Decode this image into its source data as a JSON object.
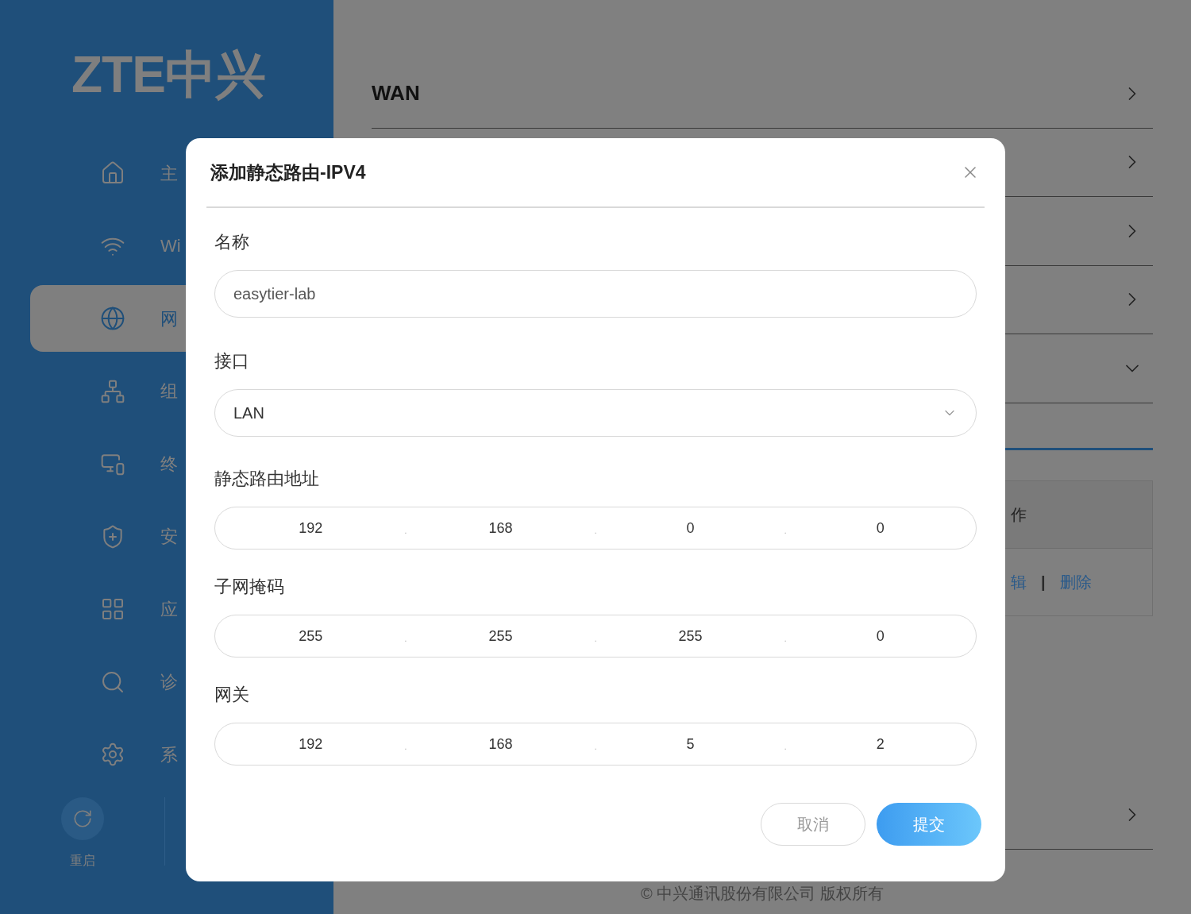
{
  "sidebar": {
    "logo": "ZTE中兴",
    "items": [
      {
        "label": "主",
        "selected": false
      },
      {
        "label": "Wi",
        "selected": false
      },
      {
        "label": "网",
        "selected": true
      },
      {
        "label": "组",
        "selected": false
      },
      {
        "label": "终",
        "selected": false
      },
      {
        "label": "安",
        "selected": false
      },
      {
        "label": "应",
        "selected": false
      },
      {
        "label": "诊",
        "selected": false
      },
      {
        "label": "系",
        "selected": false
      }
    ],
    "restart": {
      "label": "重启"
    }
  },
  "main": {
    "rows": [
      {
        "label": "WAN",
        "expanded": false
      },
      {
        "expanded": false
      },
      {
        "expanded": false
      },
      {
        "expanded": false
      },
      {
        "expanded": true
      }
    ],
    "table": {
      "header": "作",
      "links": [
        "辑",
        "删除"
      ],
      "separator": "|"
    },
    "last_row": {
      "expanded": false
    },
    "footer": "© 中兴通讯股份有限公司 版权所有"
  },
  "dialog": {
    "title": "添加静态路由-IPV4",
    "fields": [
      {
        "kind": "text",
        "label": "名称",
        "value": "easytier-lab"
      },
      {
        "kind": "select",
        "label": "接口",
        "value": "LAN"
      },
      {
        "kind": "ip",
        "label": "静态路由地址",
        "octets": [
          "192",
          "168",
          "0",
          "0"
        ],
        "separator": "."
      },
      {
        "kind": "ip",
        "label": "子网掩码",
        "octets": [
          "255",
          "255",
          "255",
          "0"
        ],
        "separator": "."
      },
      {
        "kind": "ip",
        "label": "网关",
        "octets": [
          "192",
          "168",
          "5",
          "2"
        ],
        "separator": "."
      }
    ],
    "cancel": "取消",
    "submit": "提交"
  }
}
